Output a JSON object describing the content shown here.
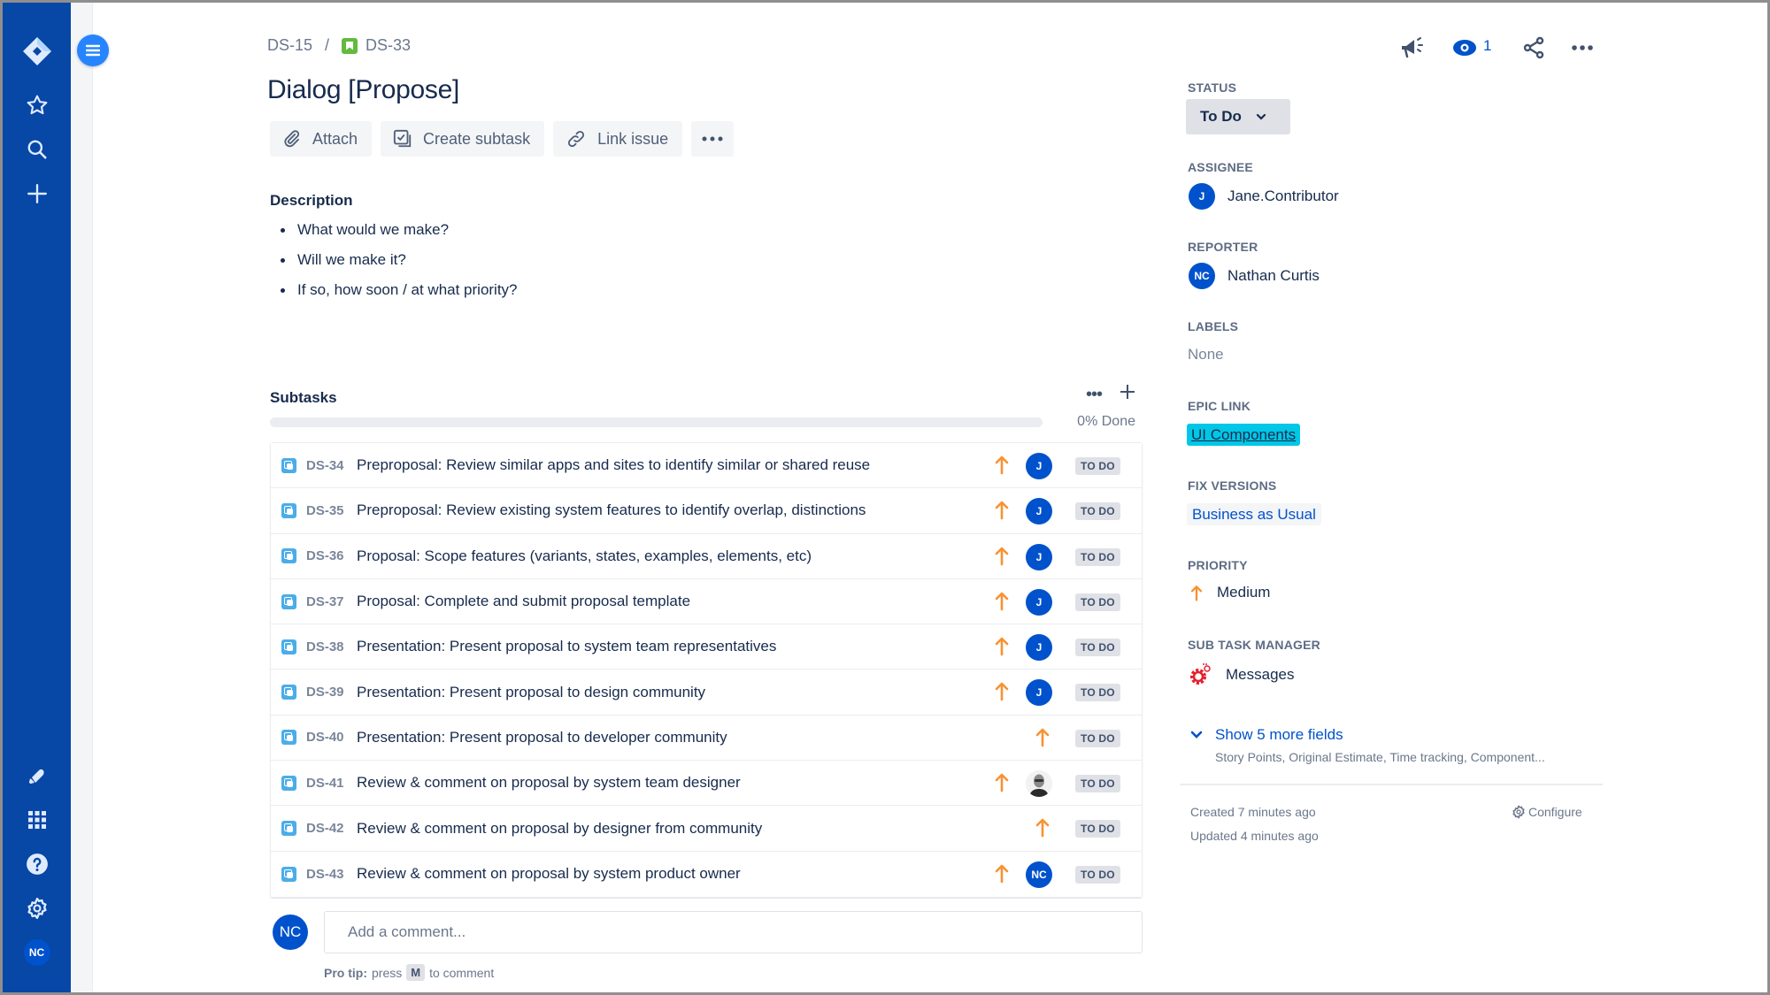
{
  "global_nav": {
    "top_icons": [
      "jira-logo-icon",
      "star-icon",
      "search-icon",
      "plus-icon"
    ],
    "bottom_icons": [
      "notifications-icon",
      "app-switcher-icon",
      "help-icon",
      "settings-icon"
    ],
    "user_initials": "NC",
    "brand_color": "#0747A6"
  },
  "breadcrumb": {
    "parent": "DS-15",
    "separator": "/",
    "current": "DS-33"
  },
  "issue": {
    "title": "Dialog [Propose]"
  },
  "actions": {
    "attach": "Attach",
    "create_subtask": "Create subtask",
    "link_issue": "Link issue"
  },
  "description": {
    "heading": "Description",
    "items": [
      "What would we make?",
      "Will we make it?",
      "If so, how soon / at what priority?"
    ]
  },
  "subtasks": {
    "heading": "Subtasks",
    "progress_done_fraction": 0,
    "progress_label": "0% Done",
    "rows": [
      {
        "key": "DS-34",
        "summary": "Preproposal: Review similar apps and sites to identify similar or shared reuse",
        "priority": "medium",
        "assignee": "J",
        "assignee_type": "initials",
        "status": "TO DO"
      },
      {
        "key": "DS-35",
        "summary": "Preproposal: Review existing system features to identify overlap, distinctions",
        "priority": "medium",
        "assignee": "J",
        "assignee_type": "initials",
        "status": "TO DO"
      },
      {
        "key": "DS-36",
        "summary": "Proposal: Scope features (variants, states, examples, elements, etc)",
        "priority": "medium",
        "assignee": "J",
        "assignee_type": "initials",
        "status": "TO DO"
      },
      {
        "key": "DS-37",
        "summary": "Proposal: Complete and submit proposal template",
        "priority": "medium",
        "assignee": "J",
        "assignee_type": "initials",
        "status": "TO DO"
      },
      {
        "key": "DS-38",
        "summary": "Presentation: Present proposal to system team representatives",
        "priority": "medium",
        "assignee": "J",
        "assignee_type": "initials",
        "status": "TO DO"
      },
      {
        "key": "DS-39",
        "summary": "Presentation: Present proposal to design community",
        "priority": "medium",
        "assignee": "J",
        "assignee_type": "initials",
        "status": "TO DO"
      },
      {
        "key": "DS-40",
        "summary": "Presentation: Present proposal to developer community",
        "priority": "medium",
        "assignee": "",
        "assignee_type": "none",
        "status": "TO DO"
      },
      {
        "key": "DS-41",
        "summary": "Review & comment on proposal by system team designer",
        "priority": "medium",
        "assignee": "",
        "assignee_type": "photo",
        "status": "TO DO"
      },
      {
        "key": "DS-42",
        "summary": "Review & comment on proposal by designer from community",
        "priority": "medium",
        "assignee": "",
        "assignee_type": "none",
        "status": "TO DO"
      },
      {
        "key": "DS-43",
        "summary": "Review & comment on proposal by system product owner",
        "priority": "medium",
        "assignee": "NC",
        "assignee_type": "initials",
        "status": "TO DO"
      }
    ]
  },
  "comment": {
    "avatar_initials": "NC",
    "placeholder": "Add a comment...",
    "protip_label": "Pro tip:",
    "protip_press": "press",
    "protip_key": "M",
    "protip_suffix": "to comment"
  },
  "header_icons": {
    "watch_count": "1"
  },
  "fields": {
    "status": {
      "label": "STATUS",
      "value": "To Do"
    },
    "assignee": {
      "label": "ASSIGNEE",
      "initials": "J",
      "name": "Jane.Contributor"
    },
    "reporter": {
      "label": "REPORTER",
      "initials": "NC",
      "name": "Nathan Curtis"
    },
    "labels": {
      "label": "LABELS",
      "value": "None"
    },
    "epic_link": {
      "label": "EPIC LINK",
      "value": "UI Components",
      "color": "#00C7E6"
    },
    "fix_versions": {
      "label": "FIX VERSIONS",
      "value": "Business as Usual"
    },
    "priority": {
      "label": "PRIORITY",
      "value": "Medium",
      "color": "#F79232"
    },
    "sub_task_manager": {
      "label": "SUB TASK MANAGER",
      "value": "Messages"
    },
    "show_more": {
      "label": "Show 5 more fields",
      "fields": "Story Points, Original Estimate, Time tracking, Component..."
    }
  },
  "meta": {
    "created": "Created 7 minutes ago",
    "updated": "Updated 4 minutes ago",
    "configure": "Configure"
  }
}
